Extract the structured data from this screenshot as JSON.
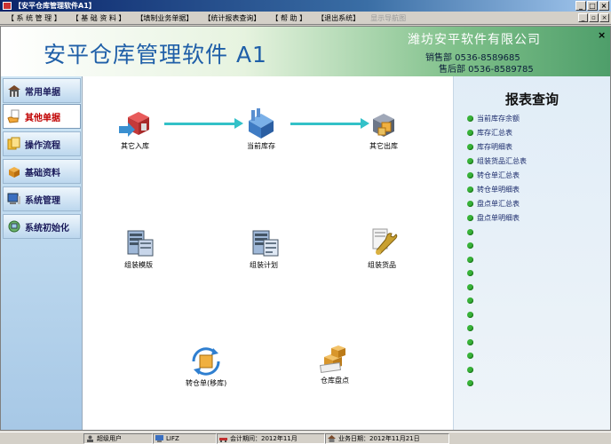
{
  "window": {
    "title": "【安平仓库管理软件A1】"
  },
  "menu": {
    "items": [
      "【 系 统 管 理 】",
      "【 基 础 资 料 】",
      "【填制业务单据】",
      "【统计报表查询】",
      "【 帮 助 】",
      "【退出系统】"
    ],
    "disabled": "显示导航图"
  },
  "header": {
    "app_title": "安平仓库管理软件 A1",
    "company": "潍坊安平软件有限公司",
    "sales_phone": "销售部  0536-8589685",
    "service_phone": "售后部  0536-8589785"
  },
  "sidebar": {
    "items": [
      {
        "label": "常用单据",
        "icon": "building-icon"
      },
      {
        "label": "其他单据",
        "icon": "hand-document-icon",
        "active": true
      },
      {
        "label": "操作流程",
        "icon": "flow-icon"
      },
      {
        "label": "基础资料",
        "icon": "box-icon"
      },
      {
        "label": "系统管理",
        "icon": "monitor-icon"
      },
      {
        "label": "系统初始化",
        "icon": "network-icon"
      }
    ]
  },
  "workspace": {
    "nodes": [
      {
        "label": "其它入库",
        "icon": "warehouse-in-icon"
      },
      {
        "label": "当前库存",
        "icon": "factory-icon"
      },
      {
        "label": "其它出库",
        "icon": "warehouse-out-icon"
      },
      {
        "label": "组装模版",
        "icon": "server-icon"
      },
      {
        "label": "组装计划",
        "icon": "server-plan-icon"
      },
      {
        "label": "组装货品",
        "icon": "tools-icon"
      },
      {
        "label": "转仓单(移库)",
        "icon": "transfer-icon"
      },
      {
        "label": "仓库盘点",
        "icon": "boxes-icon"
      }
    ]
  },
  "reports": {
    "title": "报表查询",
    "items": [
      "当前库存余额",
      "库存汇总表",
      "库存明细表",
      "组装货品汇总表",
      "转仓单汇总表",
      "转仓单明细表",
      "盘点单汇总表",
      "盘点单明细表"
    ],
    "empty_bullets": 12
  },
  "status": {
    "user": "超级用户",
    "code": "LIFZ",
    "period": "会计期间：2012年11月",
    "date": "业务日期：2012年11月21日"
  },
  "colors": {
    "accent_blue": "#1f5fa8",
    "arrow": "#33c1c8",
    "bullet": "#39b339",
    "active_nav": "#c00000"
  }
}
